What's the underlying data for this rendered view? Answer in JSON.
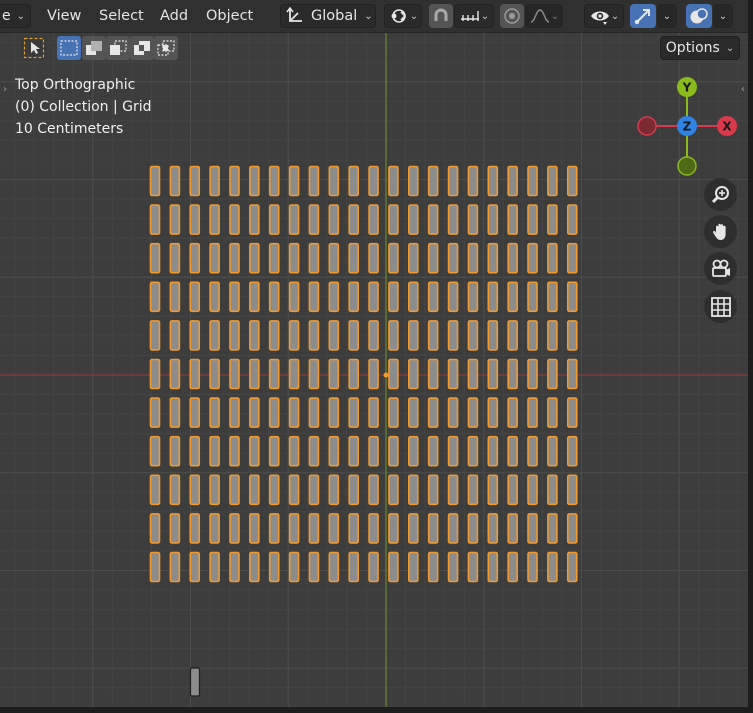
{
  "header": {
    "editor_type_label": "e",
    "menus": [
      "View",
      "Select",
      "Add",
      "Object"
    ],
    "transform_orientation": "Global"
  },
  "toolbar": {
    "options_label": "Options"
  },
  "viewport": {
    "view_name": "Top Orthographic",
    "collection_info": "(0) Collection | Grid",
    "grid_scale": "10 Centimeters"
  },
  "gizmo": {
    "axis_y": "Y",
    "axis_z": "Z",
    "axis_x": "X",
    "colors": {
      "x": "#d83a4c",
      "y": "#8aba1c",
      "z": "#2f83e4"
    }
  },
  "grid_objects": {
    "columns": 22,
    "rows": 11,
    "fill_color": "#8c8c8c",
    "selected_outline_color": "#f09a30"
  },
  "colors": {
    "accent": "#4772b3",
    "x_axis_line": "#9a3a3a",
    "y_axis_line": "#6f9a2a"
  },
  "icons": {
    "select_tool": "cursor-arrow-icon",
    "box_select": "box-select-icon",
    "transform_orientation": "axes-icon",
    "pivot": "pivot-icon",
    "snap": "magnet-icon",
    "snap_increment": "increment-icon",
    "proportional": "proportional-icon",
    "falloff": "falloff-curve-icon",
    "visibility": "eye-icon",
    "gizmo": "gizmo-icon",
    "overlays": "overlays-icon",
    "zoom": "zoom-icon",
    "pan": "hand-icon",
    "camera": "camera-icon",
    "ortho_toggle": "grid-icon"
  }
}
